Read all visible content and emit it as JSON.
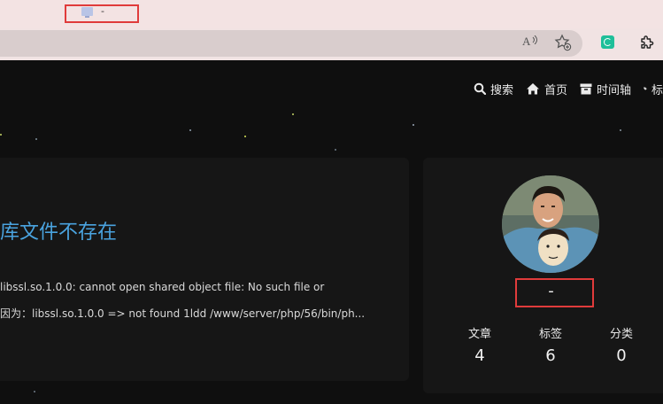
{
  "browser": {
    "tab_title": "-",
    "icons": [
      "read-aloud-icon",
      "favorite-icon",
      "extension-icon",
      "puzzle-icon"
    ]
  },
  "nav": {
    "items": [
      {
        "label": "搜索",
        "icon": "search-icon"
      },
      {
        "label": "首页",
        "icon": "home-icon"
      },
      {
        "label": "时间轴",
        "icon": "archive-icon"
      },
      {
        "label": "标",
        "icon": "tag-icon"
      }
    ]
  },
  "post": {
    "title": "库文件不存在",
    "line1": "libssl.so.1.0.0: cannot open shared object file: No such file or",
    "line2": "因为：libssl.so.1.0.0 => not found 1ldd /www/server/php/56/bin/ph..."
  },
  "profile": {
    "name": "-",
    "stats": [
      {
        "label": "文章",
        "value": "4"
      },
      {
        "label": "标签",
        "value": "6"
      },
      {
        "label": "分类",
        "value": "0"
      }
    ]
  },
  "colors": {
    "accent": "#4aa3df",
    "highlight": "#e03b3b",
    "background": "#0f0f0f",
    "card": "#161616"
  }
}
